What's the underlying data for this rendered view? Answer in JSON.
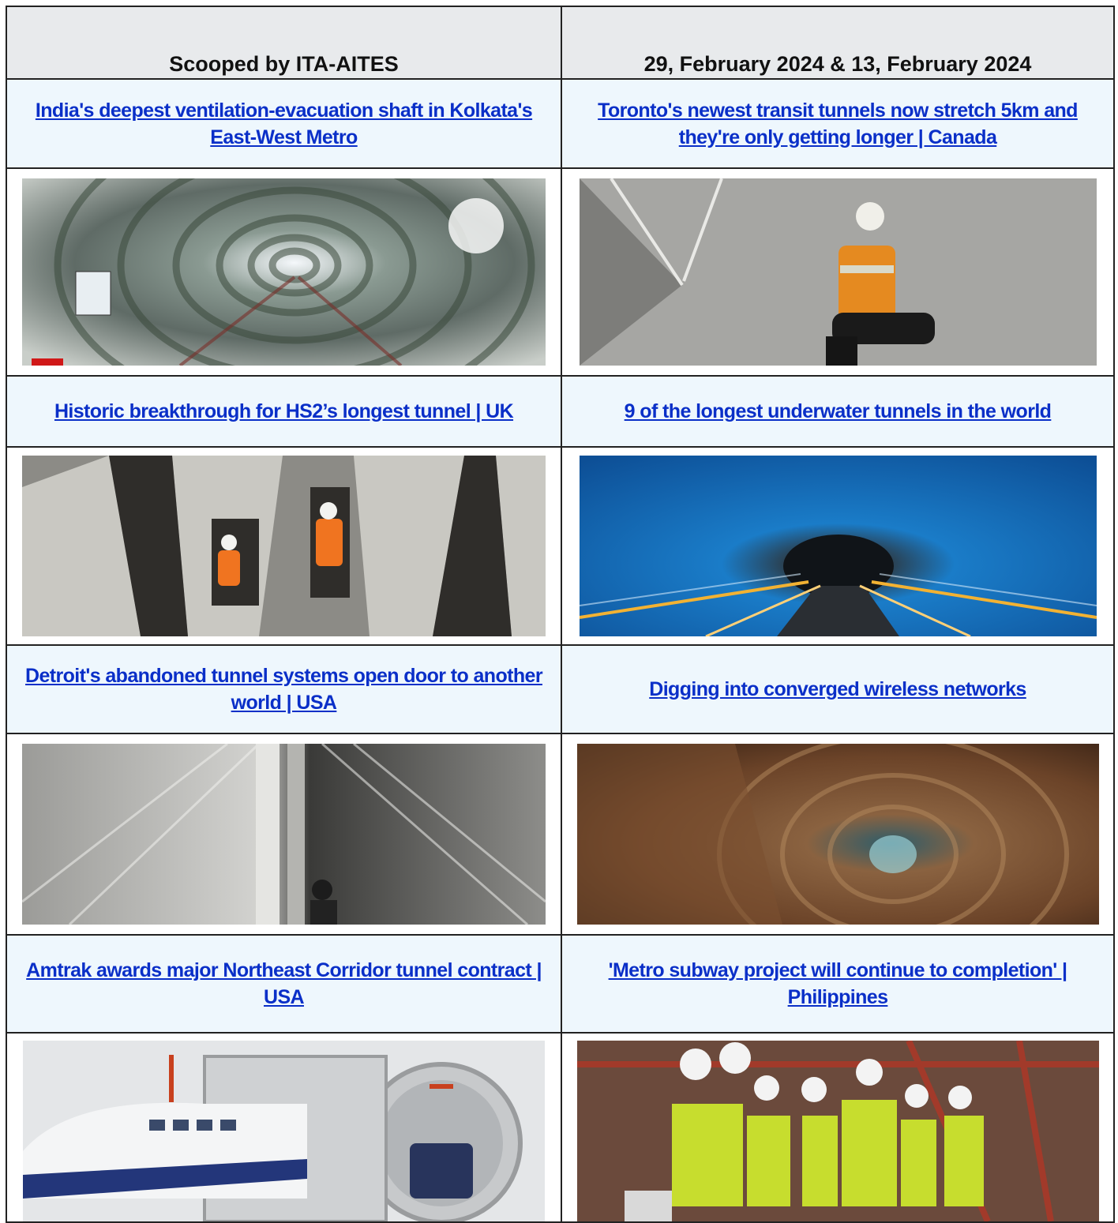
{
  "header": {
    "left": "Scooped by ITA-AITES",
    "right": "29, February 2024  & 13, February 2024"
  },
  "articles": [
    {
      "title": "India's deepest ventilation-evacuation shaft in Kolkata's East-West Metro",
      "image_icon": "metro-tunnel-photo"
    },
    {
      "title": "Toronto's newest transit tunnels now stretch 5km and they're only getting longer | Canada",
      "image_icon": "tunnel-worker-photo"
    },
    {
      "title": "Historic breakthrough for HS2’s longest tunnel | UK",
      "image_icon": "tbm-breakthrough-photo"
    },
    {
      "title": "9 of the longest underwater tunnels in the world",
      "image_icon": "blue-road-tunnel-photo"
    },
    {
      "title": "Detroit's abandoned tunnel systems open door to another world | USA",
      "image_icon": "salt-mine-tunnel-photo"
    },
    {
      "title": "Digging into converged wireless networks",
      "image_icon": "rock-tunnel-photo"
    },
    {
      "title": "Amtrak awards major Northeast Corridor tunnel contract | USA",
      "image_icon": "train-tunnel-render"
    },
    {
      "title": "'Metro subway project will continue to completion' | Philippines",
      "image_icon": "site-visit-photo"
    }
  ],
  "colors": {
    "link": "#0a2fc8",
    "header_bg": "#e8eaec",
    "title_bg": "#eef7fd",
    "border": "#222222"
  }
}
